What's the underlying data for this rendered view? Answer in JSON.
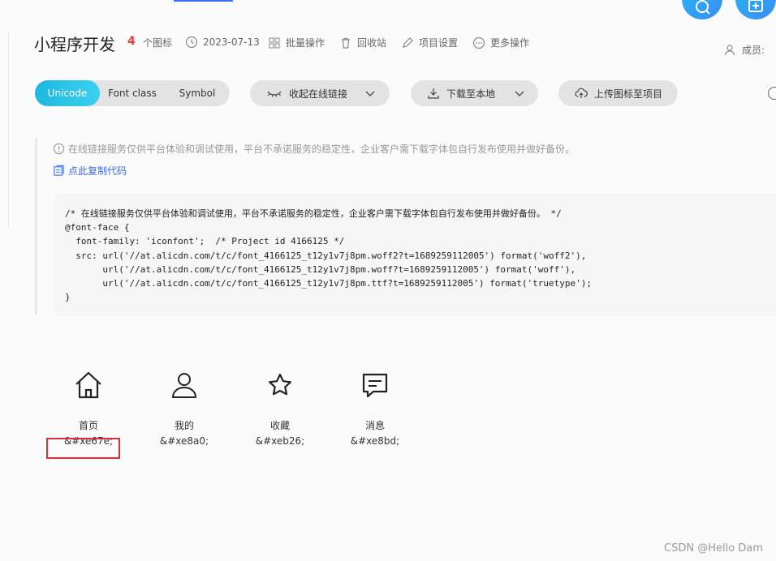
{
  "project": {
    "title": "小程序开发",
    "icon_count": "4",
    "icon_count_label": "个图标",
    "date": "2023-07-13",
    "actions": [
      {
        "label": "批量操作",
        "icon": "batch-icon"
      },
      {
        "label": "回收站",
        "icon": "trash-icon"
      },
      {
        "label": "项目设置",
        "icon": "edit-icon"
      },
      {
        "label": "更多操作",
        "icon": "more-icon"
      }
    ],
    "member_label": "成员:"
  },
  "format_tabs": [
    {
      "label": "Unicode",
      "active": true
    },
    {
      "label": "Font class",
      "active": false
    },
    {
      "label": "Symbol",
      "active": false
    }
  ],
  "toolbar": {
    "collapse_label": "收起在线链接",
    "download_label": "下载至本地",
    "upload_label": "上传图标至项目"
  },
  "notice": {
    "text": "在线链接服务仅供平台体验和调试使用，平台不承诺服务的稳定性，企业客户需下载字体包自行发布使用并做好备份。",
    "copy_label": "点此复制代码"
  },
  "code_lines": [
    "/* 在线链接服务仅供平台体验和调试使用，平台不承诺服务的稳定性，企业客户需下载字体包自行发布使用并做好备份。 */",
    "@font-face {",
    "  font-family: 'iconfont';  /* Project id 4166125 */",
    "  src: url('//at.alicdn.com/t/c/font_4166125_t12y1v7j8pm.woff2?t=1689259112005') format('woff2'),",
    "       url('//at.alicdn.com/t/c/font_4166125_t12y1v7j8pm.woff?t=1689259112005') format('woff'),",
    "       url('//at.alicdn.com/t/c/font_4166125_t12y1v7j8pm.ttf?t=1689259112005') format('truetype');",
    "}"
  ],
  "icons": [
    {
      "name": "首页",
      "code": "&#xe67e;",
      "icon": "home-icon"
    },
    {
      "name": "我的",
      "code": "&#xe8a0;",
      "icon": "user-icon"
    },
    {
      "name": "收藏",
      "code": "&#xeb26;",
      "icon": "star-icon"
    },
    {
      "name": "消息",
      "code": "&#xe8bd;",
      "icon": "message-icon"
    }
  ],
  "watermark": "CSDN @Hello Dam"
}
